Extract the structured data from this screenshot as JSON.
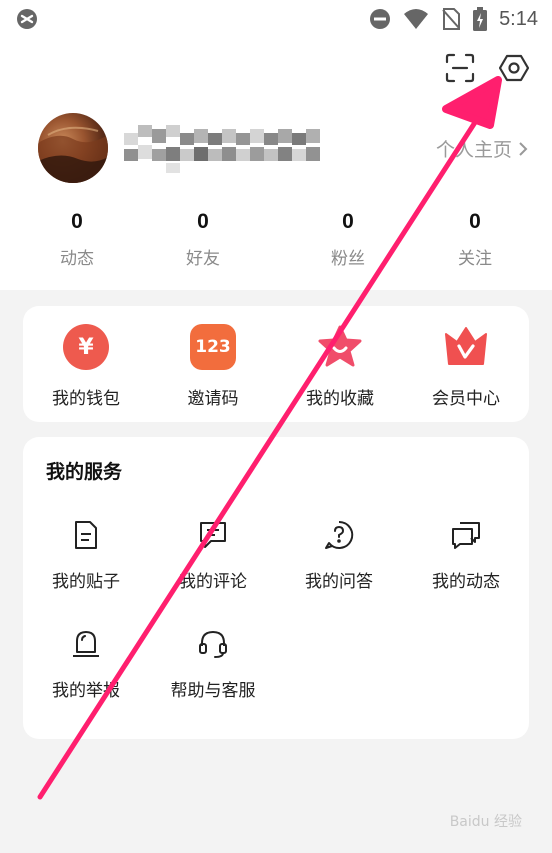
{
  "status_bar": {
    "time": "5:14",
    "icons": [
      "app-logo-icon",
      "do-not-disturb-icon",
      "wifi-icon",
      "no-sim-icon",
      "battery-charging-icon"
    ]
  },
  "header": {
    "scan_icon": "scan-icon",
    "settings_icon": "settings-hexagon-icon"
  },
  "profile": {
    "username_pixelated": true,
    "homepage_label": "个人主页"
  },
  "stats": [
    {
      "value": "0",
      "label": "动态"
    },
    {
      "value": "0",
      "label": "好友"
    },
    {
      "value": "0",
      "label": "粉丝"
    },
    {
      "value": "0",
      "label": "关注"
    }
  ],
  "quick_actions": [
    {
      "label": "我的钱包",
      "icon": "yuan-icon",
      "glyph": "¥",
      "color": "#ee5a4e"
    },
    {
      "label": "邀请码",
      "icon": "code-123-icon",
      "glyph": "123",
      "color": "#f26d3d"
    },
    {
      "label": "我的收藏",
      "icon": "star-icon",
      "glyph": "",
      "color": "#f04d6a"
    },
    {
      "label": "会员中心",
      "icon": "crown-icon",
      "glyph": "V",
      "color": "#f05050"
    }
  ],
  "services": {
    "title": "我的服务",
    "items": [
      {
        "label": "我的贴子",
        "icon": "document-icon"
      },
      {
        "label": "我的评论",
        "icon": "comment-icon"
      },
      {
        "label": "我的问答",
        "icon": "question-icon"
      },
      {
        "label": "我的动态",
        "icon": "chat-bubbles-icon"
      },
      {
        "label": "我的举报",
        "icon": "alarm-icon"
      },
      {
        "label": "帮助与客服",
        "icon": "headset-icon"
      }
    ]
  },
  "annotation": {
    "arrow_color": "#ff1f6e"
  },
  "watermark": "Baidu 经验"
}
